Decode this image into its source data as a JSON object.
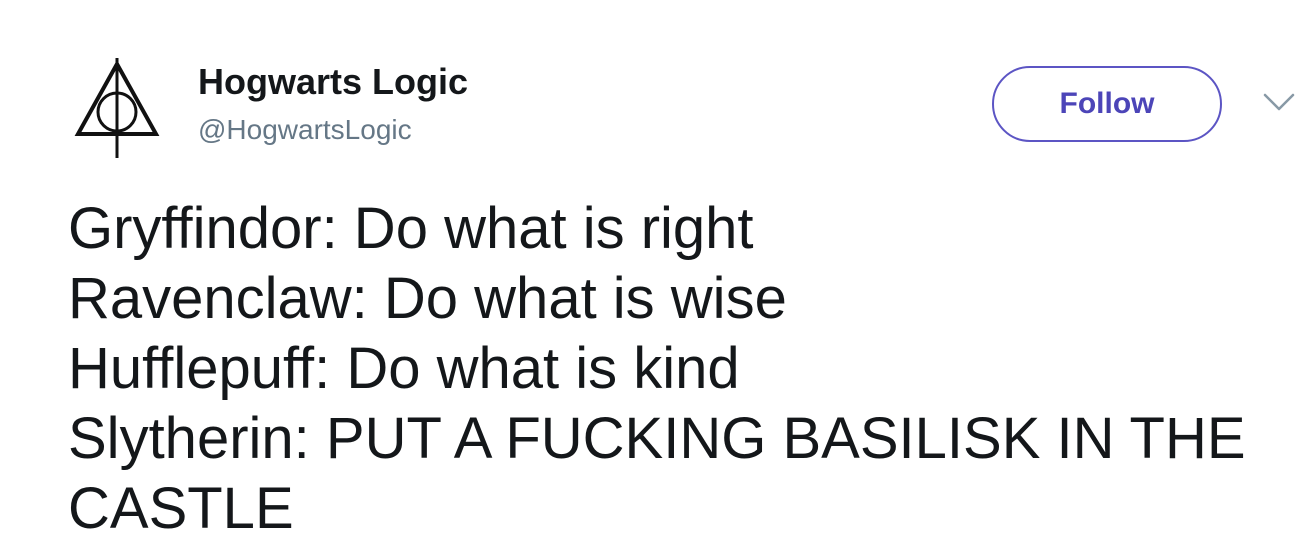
{
  "account": {
    "display_name": "Hogwarts Logic",
    "handle": "@HogwartsLogic",
    "avatar_icon": "deathly-hallows-icon"
  },
  "actions": {
    "follow_label": "Follow",
    "menu_icon": "chevron-down-icon"
  },
  "tweet": {
    "lines": [
      "Gryffindor: Do what is right",
      "Ravenclaw: Do what is wise",
      "Hufflepuff: Do what is kind",
      "Slytherin: PUT A FUCKING BASILISK IN THE",
      "CASTLE"
    ]
  },
  "colors": {
    "text": "#14171a",
    "handle": "#657786",
    "follow_border": "#5c55c4",
    "follow_text": "#4c45b8",
    "background": "#ffffff"
  }
}
